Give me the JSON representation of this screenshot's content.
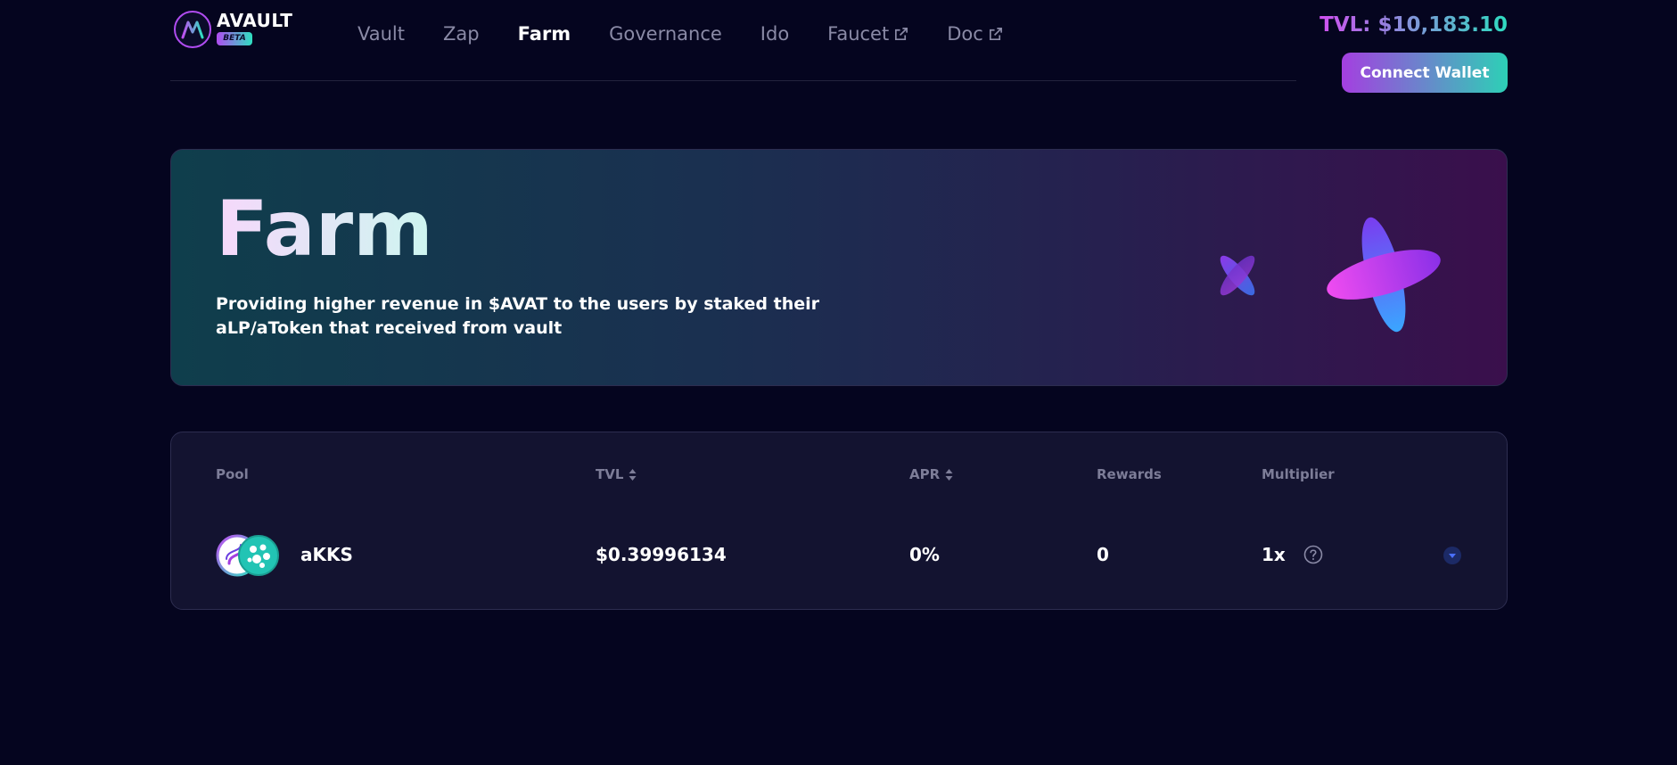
{
  "brand": {
    "name": "AVAULT",
    "badge": "BETA"
  },
  "nav": {
    "items": [
      {
        "label": "Vault",
        "active": false,
        "external": false
      },
      {
        "label": "Zap",
        "active": false,
        "external": false
      },
      {
        "label": "Farm",
        "active": true,
        "external": false
      },
      {
        "label": "Governance",
        "active": false,
        "external": false
      },
      {
        "label": "Ido",
        "active": false,
        "external": false
      },
      {
        "label": "Faucet",
        "active": false,
        "external": true
      },
      {
        "label": "Doc",
        "active": false,
        "external": true
      }
    ]
  },
  "header": {
    "tvl": "TVL: $10,183.10",
    "connect_label": "Connect Wallet"
  },
  "hero": {
    "title": "Farm",
    "description": "Providing higher revenue in $AVAT to the users by staked their aLP/aToken that received from vault"
  },
  "table": {
    "columns": {
      "pool": "Pool",
      "tvl": "TVL",
      "apr": "APR",
      "rewards": "Rewards",
      "multiplier": "Multiplier"
    },
    "rows": [
      {
        "pool": "aKKS",
        "tvl": "$0.39996134",
        "apr": "0%",
        "rewards": "0",
        "multiplier": "1x"
      }
    ]
  },
  "icons": {
    "logo": "avault-logo-icon",
    "external": "external-link-icon",
    "sort": "sort-icon",
    "help": "help-circle-icon",
    "expand": "chevron-down-icon"
  },
  "colors": {
    "background": "#05051f",
    "accent_purple": "#a43fe0",
    "accent_teal": "#2dd0b6",
    "card": "#131330",
    "muted_text": "#7d7d98"
  }
}
